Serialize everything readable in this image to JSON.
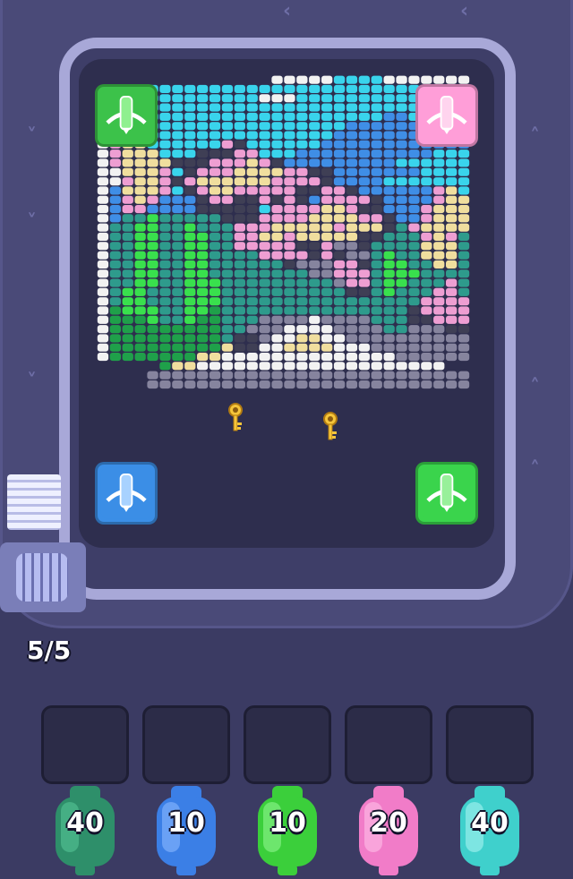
{
  "board": {
    "cols": 30,
    "rows": 34,
    "palette": {
      "W": "#f2f2f2",
      "C": "#39d4ec",
      "B": "#3f8ee6",
      "P": "#ee9ed2",
      "Y": "#f0de9e",
      "G": "#39e04d",
      "D": "#2e9b8c",
      "K": "#3f3f55",
      "R": "#86849e",
      "N": "#1fa04a"
    },
    "rows_map": [
      "..............WWWWWCCCCWWWWWWWWW...",
      "....CCCCCCCCCCCCCCCCCCCCCCCCCCCC",
      "....CCCCCCCCCWWWCCCCCCCCCCCCCCCC",
      "....CCCCCCCCCCCCCCCCCCCCCCCCCCCC",
      "CCCCCCCCCCCCCCCCCCCCCCCBBCCCCCCC",
      "CCCCCCCCCCCCCCCCCCCCBBBBBBCCCCCC",
      "WWWWCCCCCCCCCCCCCCCBBBBBBBBBCCCC",
      "WPYYCCCCCCPKCCCCCCBBBBBBBBBBBBCC",
      "WPYYYCCCKKKPPCCCBBBBBBBBBBBCCCCC",
      "WPYYYYKKKPPPYPKBBBBBBBBBCCCCCCCC",
      "WWYYYPCKPPPYYYYPPKKBBBBBBBCCCCCC",
      "WWPYYPKPYYYYYYPPPPKBBBBCCCCCCCCC",
      "WBYYYPCKPYYPPPPPKKPPKBBBBBBPYCCC",
      "WBPYPBBBKPPKKPKPKBPPPPKBBBBPYYCC",
      "WBPPBBBBKKKKKCPPPPYYPKKBBBPYYYCC",
      "WBDDGDDDDDKKKPPPPYYYYPPKBBPYYYCC",
      "WDDGGDDGDDDPPPYYYYYPYYYKDPYYYYDD",
      "WDDGGDDGGDDPPYYPYYYYYKKDDDPYPDDD",
      "WDDGGDDGGDDPPPPPKKPRRKDDDDYYYDDD",
      "WDDGGDDGGDDDDPPPPKPKRRDGDDYYYDDD",
      "WDDGGDDGGDDDDDDKRRRPPKDGGDDYYDDD",
      "WDDGGDDGGDDDDDDDDRRPPPDGGGDDDDDD",
      "WDDGGDDGGGDDDDDDDDDRPPDGGDDDPDDD",
      "WDGGDDDGGGDDDDDDDDDDKKDGDDDPPDDD",
      "WDGGDDDGGGDDDDDDDDDDDDDDDDPPPPDD",
      "WNGGGDDGGNDDDDDDDDDDDDDDDKPPPPDD",
      "WNNNGDDGNNDDDRRRRWRRRRDDDKKPPPDD",
      "WNNNNNNNNNDDRRRWWWWRRRRDDRRRKKDD",
      "WNNNNNNNNNDKKRWWYYWWRRRRRRRRRRDD",
      "WNNNNNNNNNYKKWWYYYYWWWRRRRRRRRDD",
      "WNNNNNNNYYWWWWWWWWWWWWWWRRRRRRDD",
      ".....NYYWWWWWWWWWWWWWWWWWWWW....",
      "....RRRRRRRRRRRRRRRRRRRRRRRRRR....",
      "....RRRRRRRRRRRRRRRRRRRRRRRRRR...."
    ]
  },
  "turrets": [
    {
      "id": "top-left",
      "color": "#3cc24a",
      "light": "#8ff08f"
    },
    {
      "id": "top-right",
      "color": "#ff9ed8",
      "light": "#ffd4ee"
    },
    {
      "id": "bottom-left",
      "color": "#3b8ee6",
      "light": "#a8d2ff"
    },
    {
      "id": "bottom-right",
      "color": "#3ad44c",
      "light": "#98f09a"
    }
  ],
  "counter": "5/5",
  "slots": [
    "",
    "",
    "",
    "",
    ""
  ],
  "ammo": [
    {
      "label": "40",
      "color": "#2e8f6a",
      "light": "#55c496"
    },
    {
      "label": "10",
      "color": "#3b7fe6",
      "light": "#8ab8ff"
    },
    {
      "label": "10",
      "color": "#3bcf3b",
      "light": "#8ff58f"
    },
    {
      "label": "20",
      "color": "#f17cc8",
      "light": "#ffc0e8"
    },
    {
      "label": "40",
      "color": "#3fd0cc",
      "light": "#a6f4f0"
    }
  ]
}
